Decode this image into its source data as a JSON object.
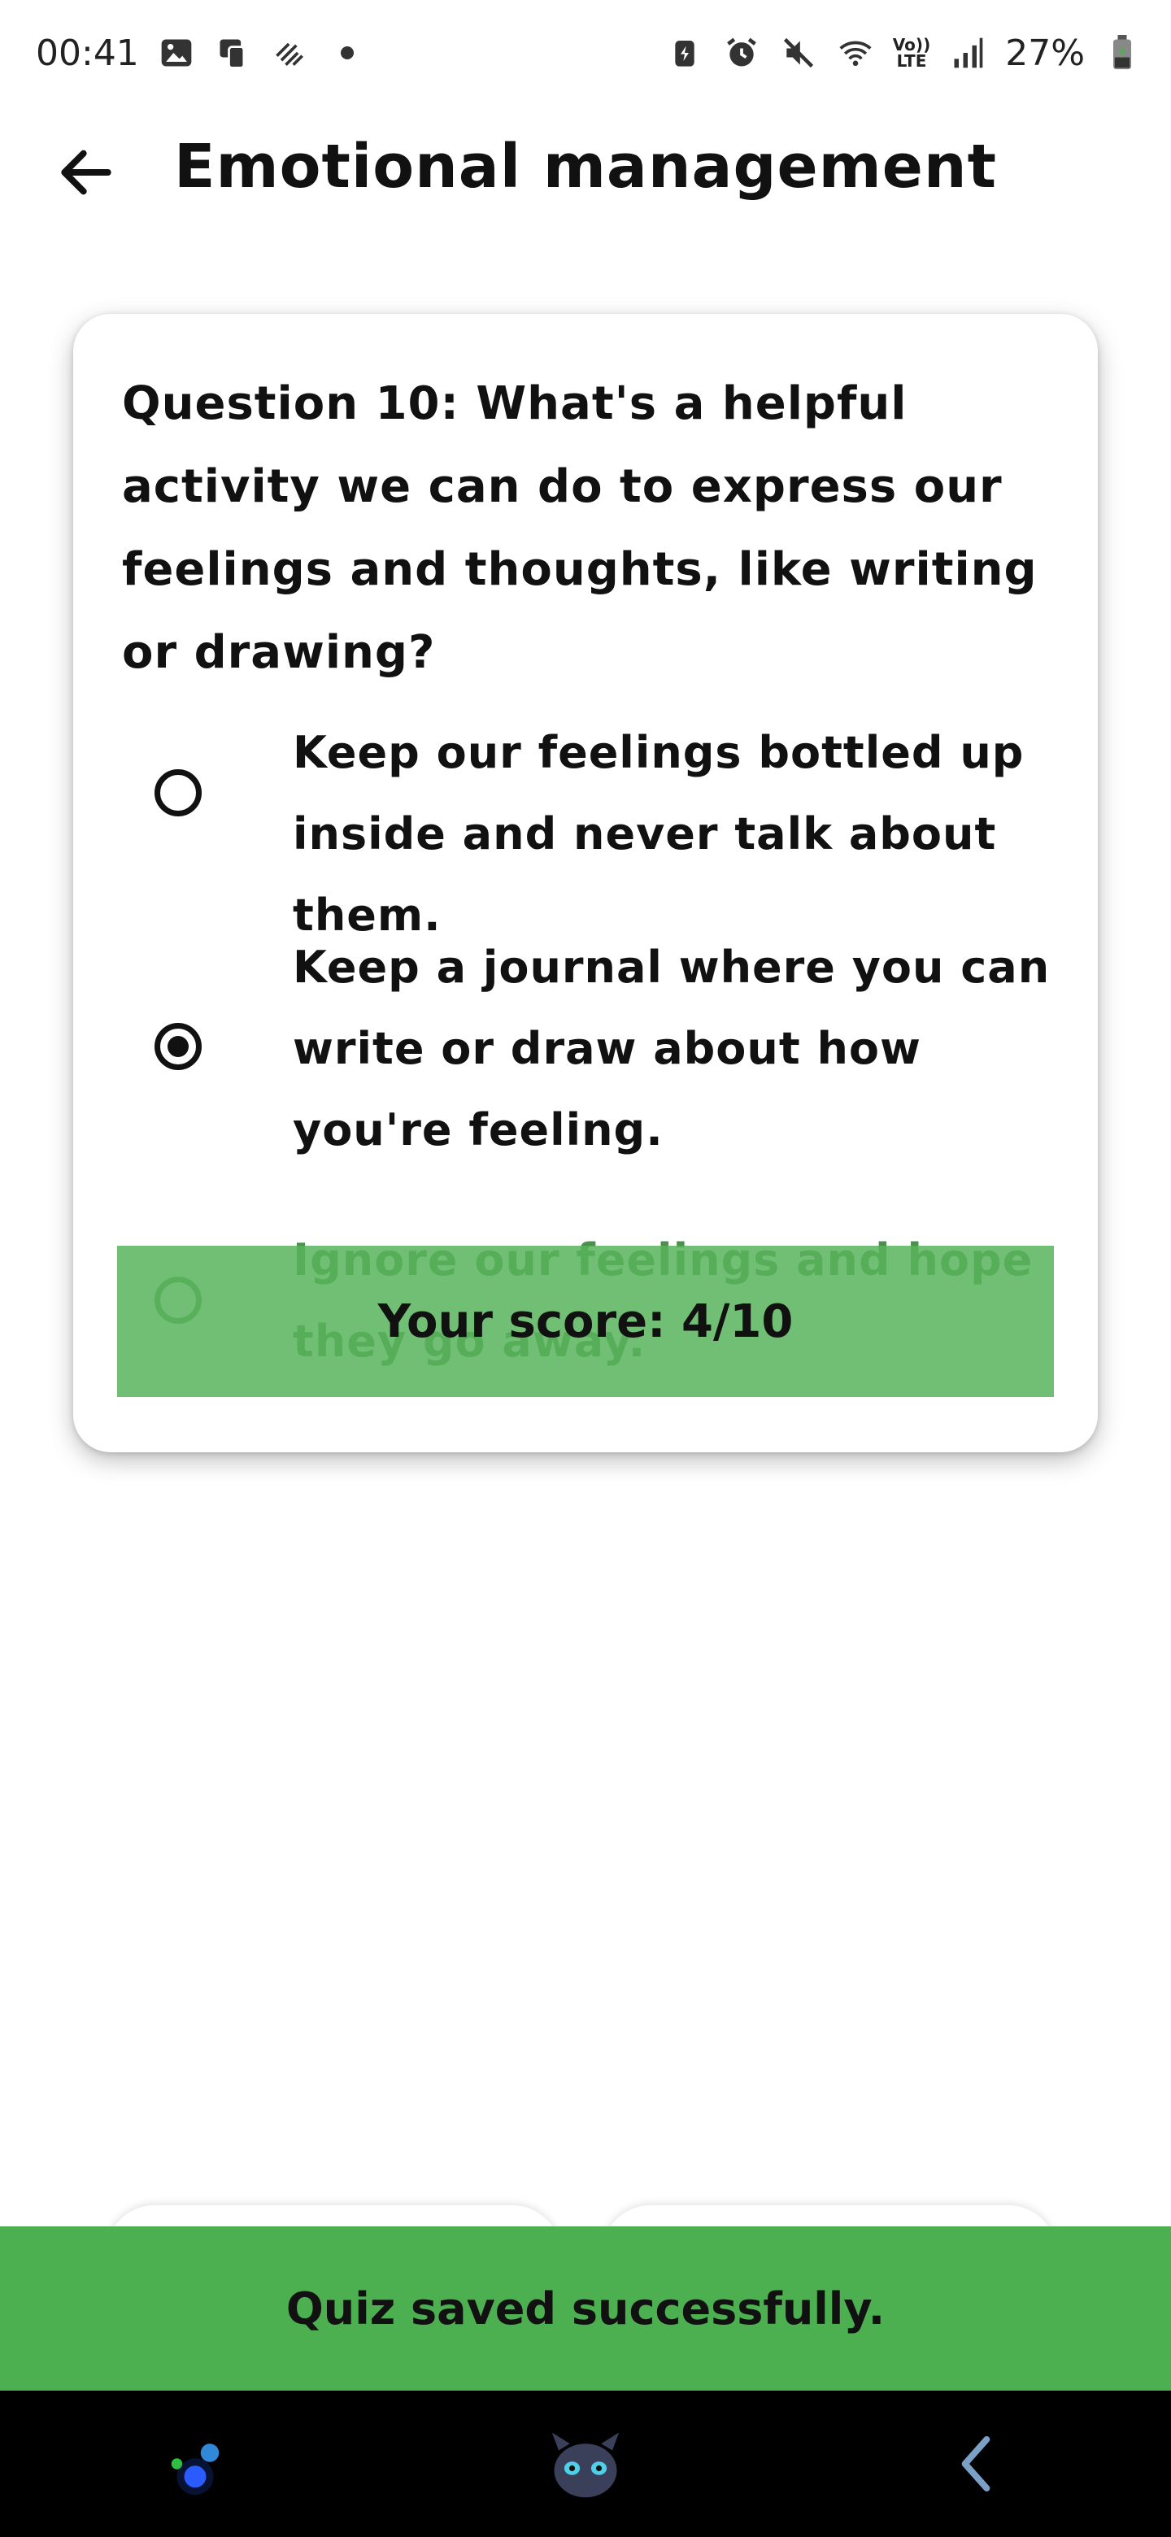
{
  "status_bar": {
    "time": "00:41",
    "battery": "27%",
    "volte_top": "Vo))",
    "volte_bottom": "LTE",
    "icons": [
      "gallery-icon",
      "device-icon",
      "edit-icon",
      "dot-icon",
      "battery-saver-icon",
      "alarm-icon",
      "mute-icon",
      "wifi-icon",
      "volte-icon",
      "signal-icon",
      "battery-icon"
    ]
  },
  "header": {
    "back_icon": "arrow-left-icon",
    "title": "Emotional management"
  },
  "question": {
    "text": "Question 10: What's a helpful activity we can do to express our feelings and thoughts, like writing or drawing?",
    "options": [
      {
        "label": "Keep our feelings bottled up inside and never talk about them.",
        "selected": false
      },
      {
        "label": "Keep a journal where you can write or draw about how you're feeling.",
        "selected": true
      },
      {
        "label": "Ignore our feelings and hope they go away.",
        "selected": false
      }
    ]
  },
  "score": {
    "text": "Your score: 4/10",
    "banner_color": "#58b45c"
  },
  "snackbar": {
    "message": "Quiz saved successfully.",
    "color": "#4caf50"
  },
  "nav_bar": {
    "items": [
      "galaxy-sparkle-icon",
      "dragon-avatar-icon",
      "back-gesture-icon"
    ]
  }
}
